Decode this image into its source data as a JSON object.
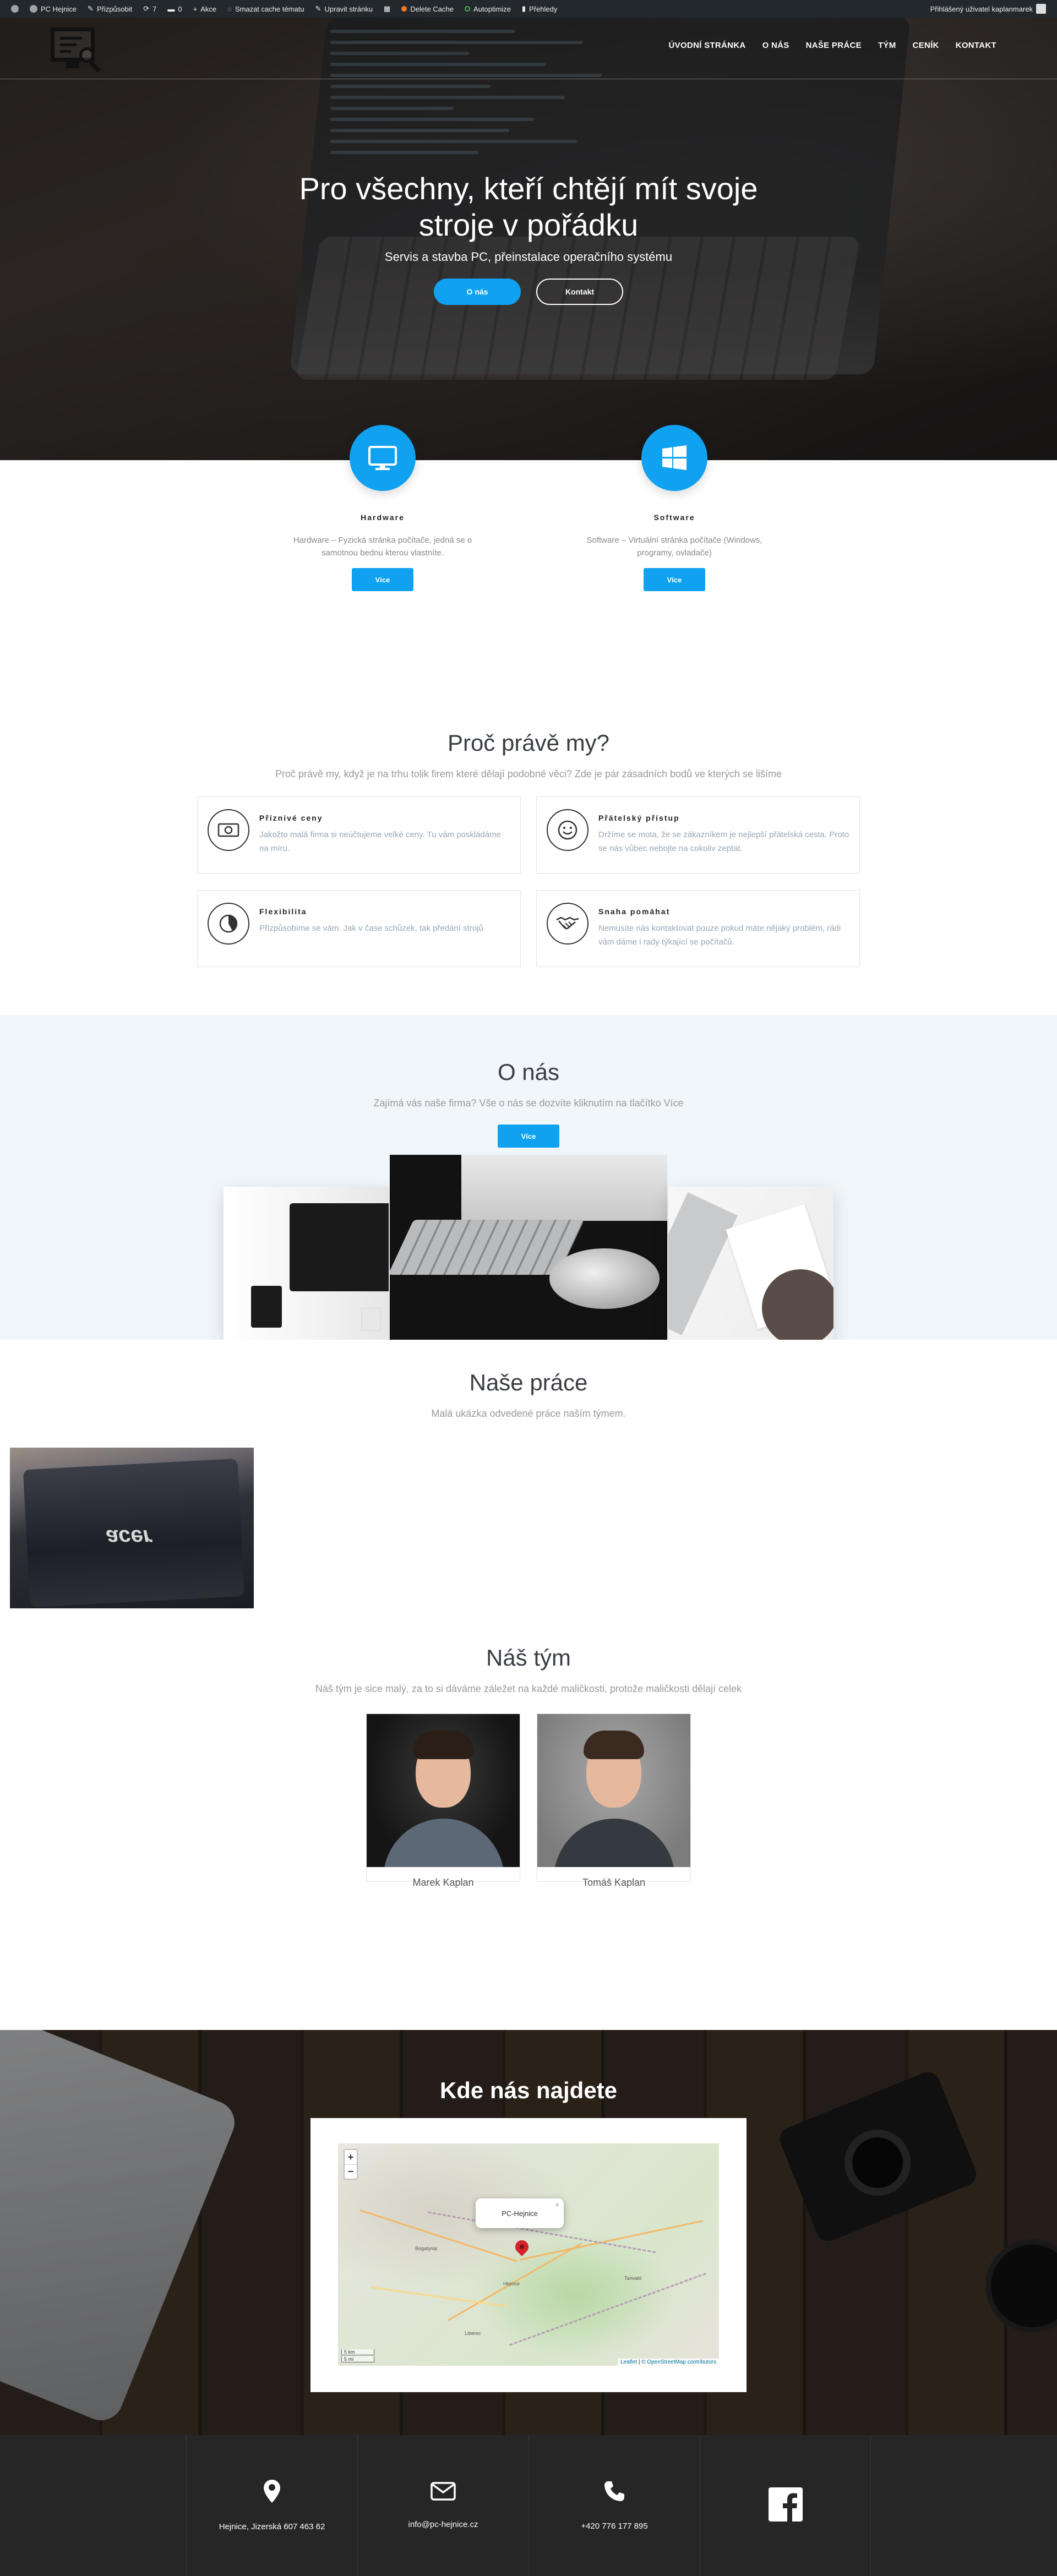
{
  "adminbar": {
    "items": [
      {
        "icon": "wordpress-icon",
        "label": ""
      },
      {
        "icon": "home-icon",
        "label": "PC Hejnice"
      },
      {
        "icon": "pencil-icon",
        "label": "Přizpůsobit"
      },
      {
        "icon": "refresh-icon",
        "label": "7"
      },
      {
        "icon": "comment-icon",
        "label": "0"
      },
      {
        "icon": "plus-icon",
        "label": "Akce"
      },
      {
        "icon": "cache-icon",
        "label": "Smazat cache tématu"
      },
      {
        "icon": "edit-icon",
        "label": "Upravit stránku"
      },
      {
        "icon": "grid-icon",
        "label": ""
      },
      {
        "icon": "orange-dot-icon",
        "label": "Delete Cache"
      },
      {
        "icon": "green-dot-icon",
        "label": "Autoptimize"
      },
      {
        "icon": "chart-icon",
        "label": "Přehledy"
      }
    ],
    "user": "Přihlášený uživatel kaplanmarek"
  },
  "nav": {
    "items": [
      "ÚVODNÍ STRÁNKA",
      "O NÁS",
      "NAŠE PRÁCE",
      "TÝM",
      "CENÍK",
      "KONTAKT"
    ]
  },
  "hero": {
    "title": "Pro všechny, kteří chtějí mít svoje stroje v pořádku",
    "subtitle": "Servis a stavba PC, přeinstalace operačního systému",
    "btn_about": "O nás",
    "btn_contact": "Kontakt"
  },
  "services": [
    {
      "title": "Hardware",
      "text": "Hardware – Fyzická stránka počítače, jedná se o samotnou bednu kterou vlastníte.",
      "button": "Více"
    },
    {
      "title": "Software",
      "text": "Software – Virtuální stránka počítače (Windows, programy, ovladače)",
      "button": "Více"
    }
  ],
  "why": {
    "title": "Proč právě my?",
    "subtitle": "Proč právě my, když je na trhu tolik firem které dělají podobné věci? Zde je pár zásadních bodů ve kterých se lišíme",
    "features": [
      {
        "title": "Příznivé ceny",
        "text": "Jakožto malá firma si neúčtujeme velké ceny. Tu vám poskládáme na míru."
      },
      {
        "title": "Přátelský přístup",
        "text": "Držíme se mota, že se zákazníkem je nejlepší přátelská cesta. Proto se nás vůbec nebojte na cokoliv zeptat."
      },
      {
        "title": "Flexibilita",
        "text": "Přizpůsobíme se vám. Jak v čase schůzek, tak předání strojů"
      },
      {
        "title": "Snaha pomáhat",
        "text": "Nemusíte nás kontaktovat pouze pokud máte nějaký problém, rádi vám dáme i rady týkající se počítačů."
      }
    ]
  },
  "about": {
    "title": "O nás",
    "subtitle": "Zajímá vás naše firma? Vše o nás se dozvíte kliknutím na tlačítko Více",
    "button": "Více"
  },
  "work": {
    "title": "Naše práce",
    "subtitle": "Malá ukázka odvedené práce naším týmem.",
    "image_text": "acer"
  },
  "team": {
    "title": "Náš tým",
    "subtitle": "Náš tým je sice malý, za to si dáváme záležet na každé maličkosti, protože maličkosti dělají celek",
    "members": [
      {
        "name": "Marek Kaplan"
      },
      {
        "name": "Tomáš Kaplan"
      }
    ]
  },
  "map": {
    "title": "Kde nás najdete",
    "popup": "PC-Hejnice",
    "zoom_in": "+",
    "zoom_out": "−",
    "scale_km": "5 km",
    "scale_mi": "5 mi",
    "attribution_leaflet": "Leaflet",
    "attribution_osm": "© OpenStreetMap contributors"
  },
  "footer": [
    {
      "icon": "location-pin-icon",
      "text": "Hejnice, Jizerská 607 463 62"
    },
    {
      "icon": "envelope-icon",
      "text": "info@pc-hejnice.cz"
    },
    {
      "icon": "phone-icon",
      "text": "+420 776 177 895"
    },
    {
      "icon": "facebook-icon",
      "text": ""
    }
  ],
  "colors": {
    "accent": "#10a2f0",
    "adminbar": "#23282d",
    "footer": "#262626",
    "about_bg": "#f1f6fb"
  }
}
